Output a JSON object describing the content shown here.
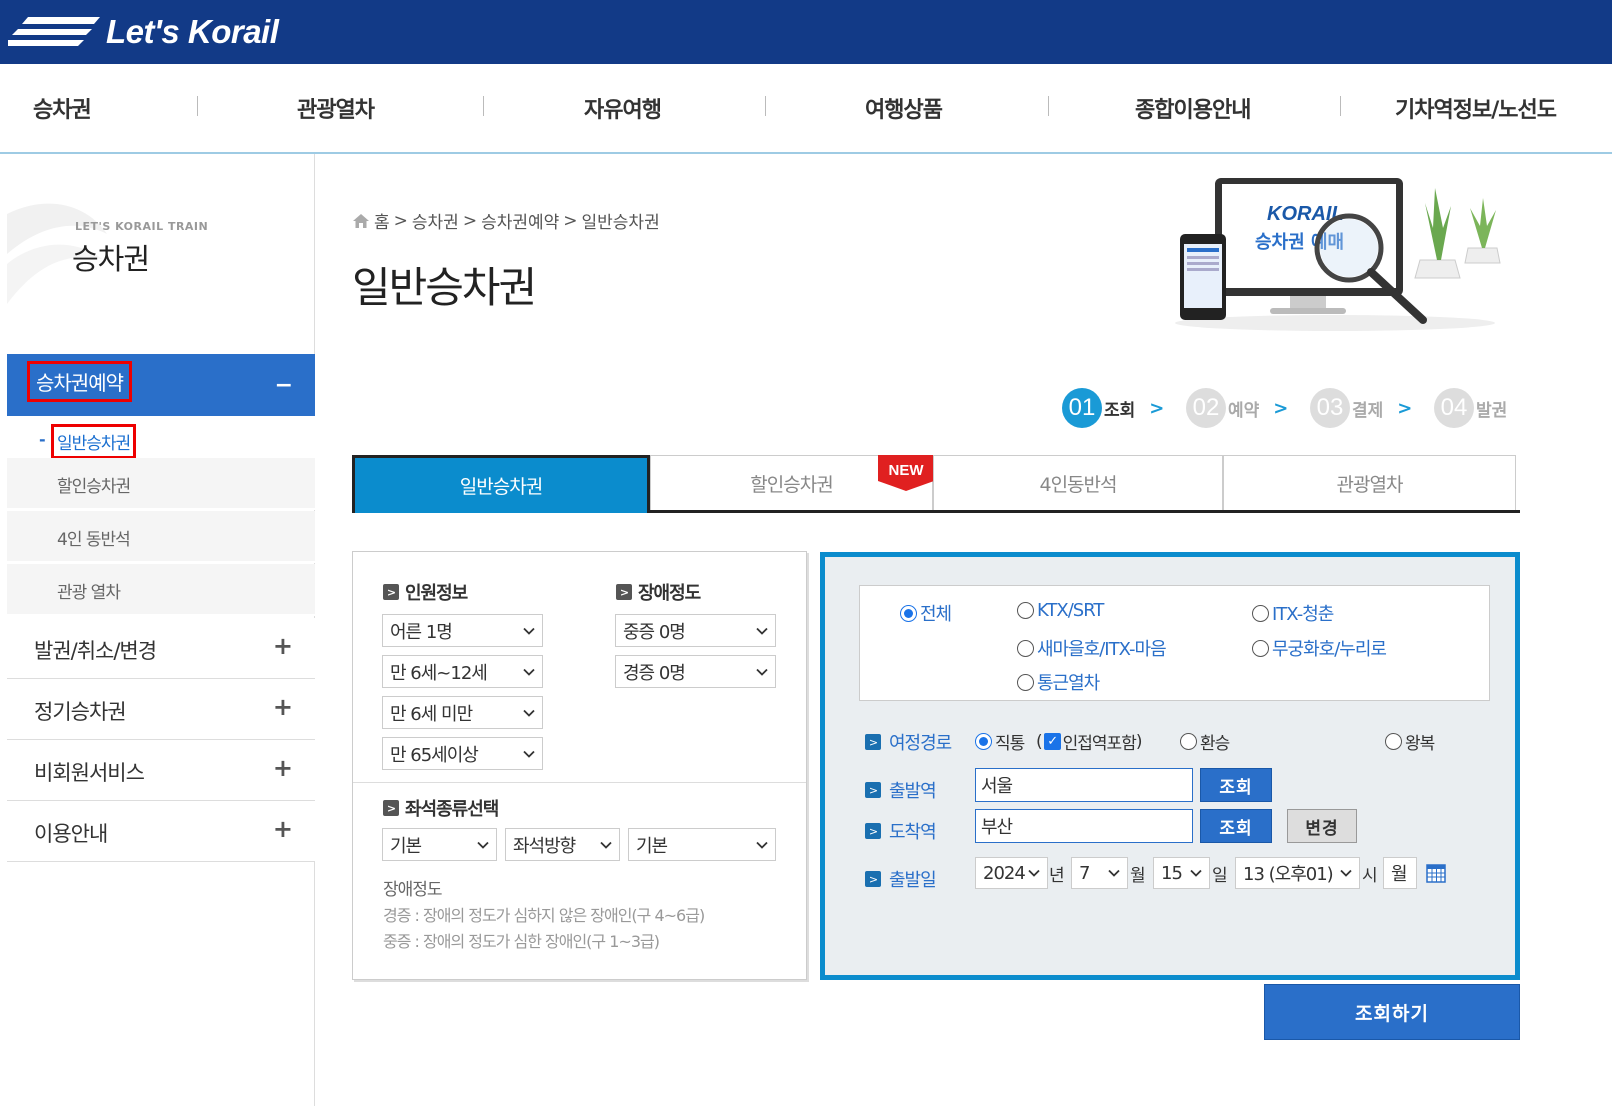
{
  "brand": {
    "logo_text": "Let's Korail"
  },
  "gnb": [
    "승차권",
    "관광열차",
    "자유여행",
    "여행상품",
    "종합이용안내",
    "기차역정보/노선도"
  ],
  "lnb": {
    "sub": "LET'S KORAIL TRAIN",
    "title": "승차권",
    "active": "승차권예약",
    "active_sub": "일반승차권",
    "subs": [
      "할인승차권",
      "4인 동반석",
      "관광 열차"
    ],
    "menus": [
      "발권/취소/변경",
      "정기승차권",
      "비회원서비스",
      "이용안내"
    ]
  },
  "breadcrumb": [
    "홈",
    "승차권",
    "승차권예약",
    "일반승차권"
  ],
  "page_title": "일반승차권",
  "illustration": {
    "logo": "KORAIL",
    "text": "승차권 예매"
  },
  "steps": [
    {
      "num": "01",
      "label": "조회",
      "active": true
    },
    {
      "num": "02",
      "label": "예약",
      "active": false
    },
    {
      "num": "03",
      "label": "결제",
      "active": false
    },
    {
      "num": "04",
      "label": "발권",
      "active": false
    }
  ],
  "tabs": [
    "일반승차권",
    "할인승차권",
    "4인동반석",
    "관광열차"
  ],
  "new_badge": "NEW",
  "passenger": {
    "title": "인원정보",
    "selects": [
      "어른 1명",
      "만 6세~12세",
      "만 6세 미만",
      "만 65세이상"
    ]
  },
  "disability": {
    "title": "장애정도",
    "selects": [
      "중증 0명",
      "경증 0명"
    ]
  },
  "seat": {
    "title": "좌석종류선택",
    "selects": [
      "기본",
      "좌석방향",
      "기본"
    ],
    "note_title": "장애정도",
    "notes": [
      "경증 : 장애의 정도가 심하지 않은 장애인(구 4~6급)",
      "중증 : 장애의 정도가 심한 장애인(구 1~3급)"
    ]
  },
  "train_types": [
    "전체",
    "KTX/SRT",
    "ITX-청춘",
    "새마을호/ITX-마음",
    "무궁화호/누리로",
    "통근열차"
  ],
  "route": {
    "label": "여정경로",
    "direct": "직통",
    "paren_open": "(",
    "adjacent": "인접역포함",
    "paren_close": ")",
    "transfer": "환승",
    "round": "왕복"
  },
  "depart": {
    "label": "출발역",
    "value": "서울",
    "btn": "조회"
  },
  "arrive": {
    "label": "도착역",
    "value": "부산",
    "btn": "조회",
    "swap": "변경"
  },
  "date": {
    "label": "출발일",
    "year": "2024",
    "year_unit": "년",
    "month": "7",
    "month_unit": "월",
    "day": "15",
    "day_unit": "일",
    "hour": "13 (오후01)",
    "hour_unit": "시",
    "weekday": "월"
  },
  "search_btn": "조회하기",
  "colors": {
    "navy": "#123a87",
    "blue": "#2a6fc9",
    "tab_blue": "#0b8ccd",
    "red": "#ee0000"
  }
}
